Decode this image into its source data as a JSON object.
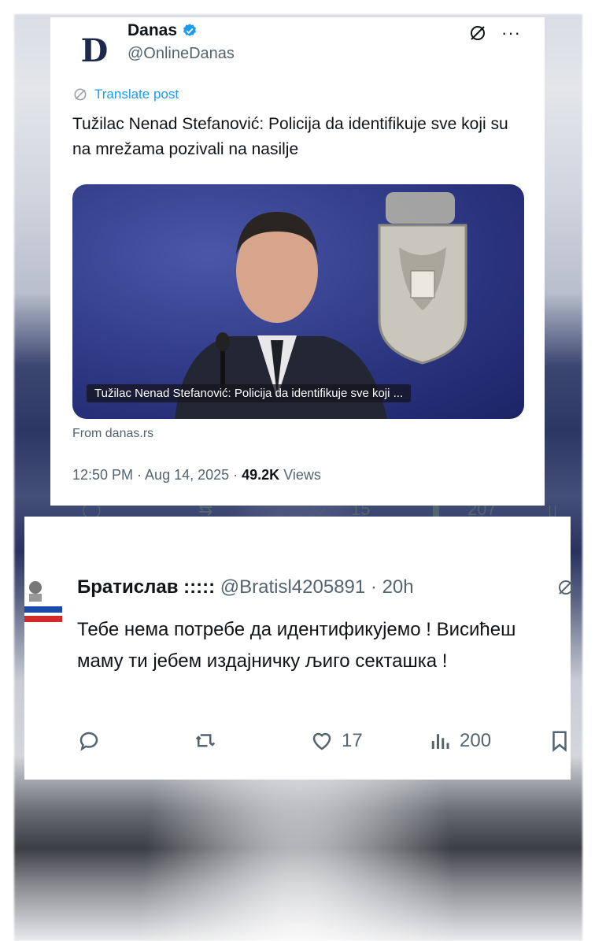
{
  "post": {
    "author_name": "Danas",
    "handle": "@OnlineDanas",
    "logo_letter": "D",
    "translate_label": "Translate post",
    "text": "Tužilac Nenad Stefanović: Policija da identifikuje sve koji su na mrežama pozivali na nasilje",
    "media_caption": "Tužilac Nenad Stefanović: Policija da identifikuje sve koji ...",
    "source": "From danas.rs",
    "timestamp": "12:50 PM · Aug 14, 2025 · ",
    "views_count": "49.2K",
    "views_label": "Views",
    "more_label": "···"
  },
  "strip": {
    "likes": "15",
    "views": "207"
  },
  "reply": {
    "name": "Братислав :::::",
    "handle": "@Bratisl4205891 · 20h",
    "text": "Тебе нема потребе да идентификујемо ! Висићеш маму ти јебем издајничку љиго секташка !",
    "likes": "17",
    "views": "200"
  },
  "colors": {
    "accent": "#1d9bf0",
    "text": "#0f1419",
    "muted": "#536471"
  }
}
